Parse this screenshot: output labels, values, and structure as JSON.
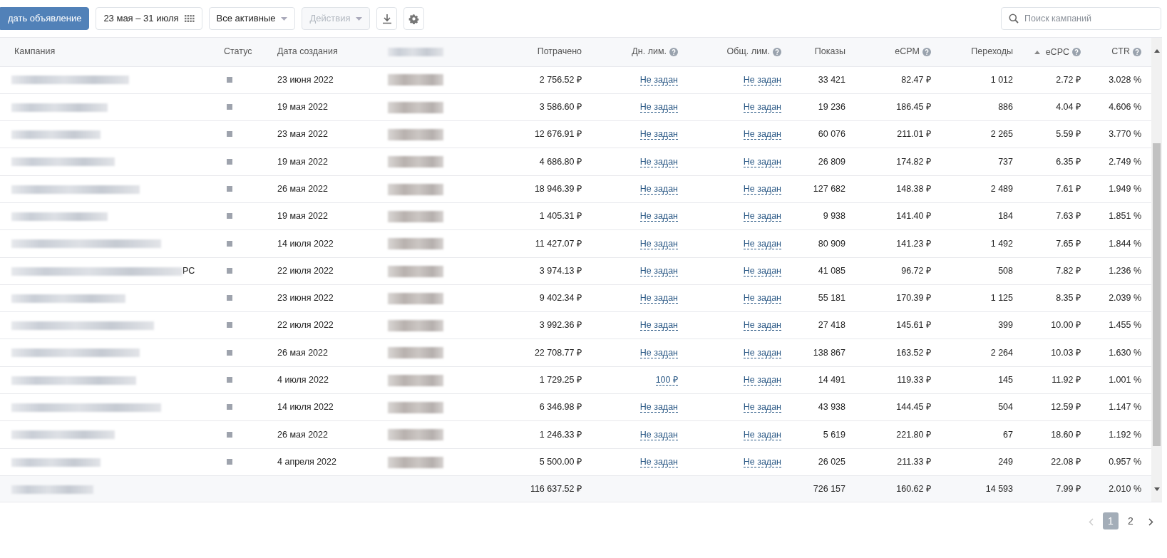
{
  "toolbar": {
    "create_button": "дать объявление",
    "date_range": "23 мая – 31 июля",
    "filter": "Все активные",
    "actions": {
      "label": "Действия",
      "disabled": true
    },
    "search": {
      "placeholder": "Поиск кампаний"
    }
  },
  "table": {
    "columns": [
      {
        "label": "Кампания"
      },
      {
        "label": "Статус"
      },
      {
        "label": "Дата создания"
      },
      {
        "kind": "blurred"
      },
      {
        "label": "Потрачено"
      },
      {
        "label": "Дн. лим.",
        "help": true
      },
      {
        "label": "Общ. лим.",
        "help": true
      },
      {
        "label": "Показы"
      },
      {
        "label": "eCPM",
        "help": true
      },
      {
        "label": "Переходы"
      },
      {
        "label": "eCPC",
        "help": true,
        "sorted": true
      },
      {
        "label": "CTR",
        "help": true
      }
    ],
    "rows": [
      {
        "date": "23 июня 2022",
        "spent": "2 756.52 ₽",
        "day_limit": "Не задан",
        "total_limit": "Не задан",
        "impressions": "33 421",
        "ecpm": "82.47 ₽",
        "clicks": "1 012",
        "ecpc": "2.72 ₽",
        "ctr": "3.028 %"
      },
      {
        "date": "19 мая 2022",
        "spent": "3 586.60 ₽",
        "day_limit": "Не задан",
        "total_limit": "Не задан",
        "impressions": "19 236",
        "ecpm": "186.45 ₽",
        "clicks": "886",
        "ecpc": "4.04 ₽",
        "ctr": "4.606 %"
      },
      {
        "date": "23 мая 2022",
        "spent": "12 676.91 ₽",
        "day_limit": "Не задан",
        "total_limit": "Не задан",
        "impressions": "60 076",
        "ecpm": "211.01 ₽",
        "clicks": "2 265",
        "ecpc": "5.59 ₽",
        "ctr": "3.770 %"
      },
      {
        "date": "19 мая 2022",
        "spent": "4 686.80 ₽",
        "day_limit": "Не задан",
        "total_limit": "Не задан",
        "impressions": "26 809",
        "ecpm": "174.82 ₽",
        "clicks": "737",
        "ecpc": "6.35 ₽",
        "ctr": "2.749 %"
      },
      {
        "date": "26 мая 2022",
        "spent": "18 946.39 ₽",
        "day_limit": "Не задан",
        "total_limit": "Не задан",
        "impressions": "127 682",
        "ecpm": "148.38 ₽",
        "clicks": "2 489",
        "ecpc": "7.61 ₽",
        "ctr": "1.949 %"
      },
      {
        "date": "19 мая 2022",
        "spent": "1 405.31 ₽",
        "day_limit": "Не задан",
        "total_limit": "Не задан",
        "impressions": "9 938",
        "ecpm": "141.40 ₽",
        "clicks": "184",
        "ecpc": "7.63 ₽",
        "ctr": "1.851 %"
      },
      {
        "date": "14 июля 2022",
        "spent": "11 427.07 ₽",
        "day_limit": "Не задан",
        "total_limit": "Не задан",
        "impressions": "80 909",
        "ecpm": "141.23 ₽",
        "clicks": "1 492",
        "ecpc": "7.65 ₽",
        "ctr": "1.844 %"
      },
      {
        "name_tail": "РС",
        "date": "22 июля 2022",
        "spent": "3 974.13 ₽",
        "day_limit": "Не задан",
        "total_limit": "Не задан",
        "impressions": "41 085",
        "ecpm": "96.72 ₽",
        "clicks": "508",
        "ecpc": "7.82 ₽",
        "ctr": "1.236 %"
      },
      {
        "date": "23 июня 2022",
        "spent": "9 402.34 ₽",
        "day_limit": "Не задан",
        "total_limit": "Не задан",
        "impressions": "55 181",
        "ecpm": "170.39 ₽",
        "clicks": "1 125",
        "ecpc": "8.35 ₽",
        "ctr": "2.039 %"
      },
      {
        "date": "22 июля 2022",
        "spent": "3 992.36 ₽",
        "day_limit": "Не задан",
        "total_limit": "Не задан",
        "impressions": "27 418",
        "ecpm": "145.61 ₽",
        "clicks": "399",
        "ecpc": "10.00 ₽",
        "ctr": "1.455 %"
      },
      {
        "date": "26 мая 2022",
        "spent": "22 708.77 ₽",
        "day_limit": "Не задан",
        "total_limit": "Не задан",
        "impressions": "138 867",
        "ecpm": "163.52 ₽",
        "clicks": "2 264",
        "ecpc": "10.03 ₽",
        "ctr": "1.630 %"
      },
      {
        "date": "4 июля 2022",
        "spent": "1 729.25 ₽",
        "day_limit": "100 ₽",
        "total_limit": "Не задан",
        "impressions": "14 491",
        "ecpm": "119.33 ₽",
        "clicks": "145",
        "ecpc": "11.92 ₽",
        "ctr": "1.001 %"
      },
      {
        "date": "14 июля 2022",
        "spent": "6 346.98 ₽",
        "day_limit": "Не задан",
        "total_limit": "Не задан",
        "impressions": "43 938",
        "ecpm": "144.45 ₽",
        "clicks": "504",
        "ecpc": "12.59 ₽",
        "ctr": "1.147 %"
      },
      {
        "date": "26 мая 2022",
        "spent": "1 246.33 ₽",
        "day_limit": "Не задан",
        "total_limit": "Не задан",
        "impressions": "5 619",
        "ecpm": "221.80 ₽",
        "clicks": "67",
        "ecpc": "18.60 ₽",
        "ctr": "1.192 %"
      },
      {
        "date": "4 апреля 2022",
        "spent": "5 500.00 ₽",
        "day_limit": "Не задан",
        "total_limit": "Не задан",
        "impressions": "26 025",
        "ecpm": "211.33 ₽",
        "clicks": "249",
        "ecpc": "22.08 ₽",
        "ctr": "0.957 %"
      }
    ],
    "total": {
      "spent": "116 637.52 ₽",
      "impressions": "726 157",
      "ecpm": "160.62 ₽",
      "clicks": "14 593",
      "ecpc": "7.99 ₽",
      "ctr": "2.010 %"
    }
  },
  "pagination": {
    "pages": [
      {
        "label": "1",
        "selected": true
      },
      {
        "label": "2",
        "selected": false
      }
    ]
  }
}
